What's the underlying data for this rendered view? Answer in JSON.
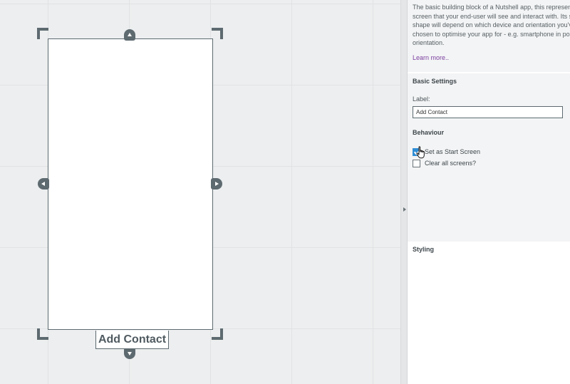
{
  "canvas": {
    "screen_label": "Add Contact"
  },
  "panel": {
    "description": [
      "The basic building block of a Nutshell app, this represents",
      "screen that your end-user will see and interact with. Its siz",
      "shape will depend on which device and orientation you've",
      "chosen to optimise your app for - e.g. smartphone in port",
      "orientation."
    ],
    "learn_more": "Learn more..",
    "basic_settings_title": "Basic Settings",
    "label_field_label": "Label:",
    "label_value": "Add Contact",
    "behaviour_title": "Behaviour",
    "start_screen_label": "Set as Start Screen",
    "start_screen_checked": true,
    "clear_screens_label": "Clear all screens?",
    "clear_screens_checked": false,
    "styling_title": "Styling"
  },
  "colors": {
    "frame": "#5d6a70",
    "link": "#7b3fa0",
    "checkbox_checked": "#2f8dd4"
  },
  "icons": {
    "resize_handles": [
      "arrow-up-icon",
      "arrow-down-icon",
      "arrow-left-icon",
      "arrow-right-icon"
    ],
    "cursor": "hand-pointer-icon"
  }
}
